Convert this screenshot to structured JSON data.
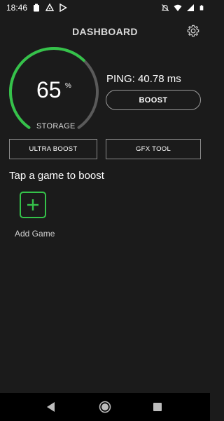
{
  "status_bar": {
    "time": "18:46",
    "left_icons": [
      "clipboard-icon",
      "app-shield-icon",
      "play-store-icon"
    ],
    "right_icons": [
      "notifications-muted-icon",
      "wifi-icon",
      "signal-icon",
      "battery-icon"
    ]
  },
  "header": {
    "title": "DASHBOARD",
    "settings_icon": "gear-icon"
  },
  "storage": {
    "value": "65",
    "unit": "%",
    "label": "STORAGE",
    "fraction": 0.65,
    "color_fill": "#35c24a",
    "color_track": "#5a5a5a"
  },
  "ping": {
    "text": "PING: 40.78 ms"
  },
  "buttons": {
    "boost": "BOOST",
    "ultra_boost": "ULTRA BOOST",
    "gfx_tool": "GFX TOOL"
  },
  "games": {
    "section_title": "Tap a game to boost",
    "add_label": "Add Game",
    "add_icon": "plus-icon",
    "accent": "#35c24a"
  },
  "nav": {
    "back_icon": "back-icon",
    "home_icon": "home-icon",
    "recents_icon": "recents-icon"
  }
}
